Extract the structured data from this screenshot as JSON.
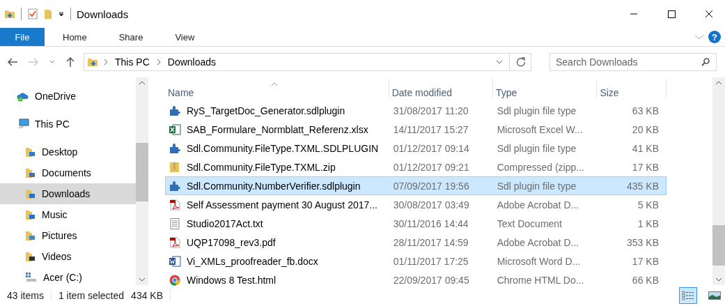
{
  "window": {
    "title": "Downloads"
  },
  "ribbon": {
    "tabs": [
      {
        "label": "File",
        "kind": "file",
        "selected": false
      },
      {
        "label": "Home",
        "kind": "tab",
        "selected": false
      },
      {
        "label": "Share",
        "kind": "tab",
        "selected": false
      },
      {
        "label": "View",
        "kind": "tab",
        "selected": false
      }
    ],
    "help": "?"
  },
  "address": {
    "crumbs": [
      "This PC",
      "Downloads"
    ],
    "search": {
      "placeholder": "Search Downloads"
    }
  },
  "sidebar": {
    "items": [
      {
        "label": "OneDrive",
        "kind": "onedrive",
        "selected": false
      },
      {
        "label": "This PC",
        "kind": "pc",
        "selected": false,
        "children": [
          {
            "label": "Desktop",
            "kind": "desktop",
            "selected": false
          },
          {
            "label": "Documents",
            "kind": "documents",
            "selected": false
          },
          {
            "label": "Downloads",
            "kind": "downloads",
            "selected": true
          },
          {
            "label": "Music",
            "kind": "music",
            "selected": false
          },
          {
            "label": "Pictures",
            "kind": "pictures",
            "selected": false
          },
          {
            "label": "Videos",
            "kind": "videos",
            "selected": false
          },
          {
            "label": "Acer (C:)",
            "kind": "drive",
            "selected": false
          }
        ]
      }
    ]
  },
  "table": {
    "columns": [
      "Name",
      "Date modified",
      "Type",
      "Size"
    ],
    "rows": [
      {
        "kind": "plugin",
        "name": "RyS_TargetDoc_Generator.sdlplugin",
        "date": "31/08/2017 11:20",
        "type": "Sdl plugin file type",
        "size": "63 KB",
        "selected": false
      },
      {
        "kind": "excel",
        "name": "SAB_Formulare_Normblatt_Referenz.xlsx",
        "date": "14/11/2017 15:27",
        "type": "Microsoft Excel W...",
        "size": "20 KB",
        "selected": false
      },
      {
        "kind": "plugin",
        "name": "Sdl.Community.FileType.TXML.SDLPLUGIN",
        "date": "01/12/2017 09:14",
        "type": "Sdl plugin file type",
        "size": "41 KB",
        "selected": false
      },
      {
        "kind": "zip",
        "name": "Sdl.Community.FileType.TXML.zip",
        "date": "01/12/2017 09:21",
        "type": "Compressed (zipp...",
        "size": "17 KB",
        "selected": false
      },
      {
        "kind": "plugin",
        "name": "Sdl.Community.NumberVerifier.sdlplugin",
        "date": "07/09/2017 19:56",
        "type": "Sdl plugin file type",
        "size": "435 KB",
        "selected": true
      },
      {
        "kind": "pdf",
        "name": "Self Assessment payment 30 August 2017...",
        "date": "30/08/2017 03:49",
        "type": "Adobe Acrobat D...",
        "size": "5 KB",
        "selected": false
      },
      {
        "kind": "text",
        "name": "Studio2017Act.txt",
        "date": "30/11/2016 14:44",
        "type": "Text Document",
        "size": "1 KB",
        "selected": false
      },
      {
        "kind": "pdf",
        "name": "UQP17098_rev3.pdf",
        "date": "28/11/2017 14:59",
        "type": "Adobe Acrobat D...",
        "size": "353 KB",
        "selected": false
      },
      {
        "kind": "word",
        "name": "Vi_XMLs_proofreader_fb.docx",
        "date": "01/11/2017 17:25",
        "type": "Microsoft Word D...",
        "size": "17 KB",
        "selected": false
      },
      {
        "kind": "chrome",
        "name": "Windows 8 Test.html",
        "date": "22/09/2017 09:45",
        "type": "Chrome HTML Do...",
        "size": "66 KB",
        "selected": false
      }
    ]
  },
  "status_bar": {
    "count": "43 items",
    "selection": "1 item selected",
    "size": "434 KB",
    "views": [
      {
        "kind": "details",
        "selected": true
      },
      {
        "kind": "thumbnails",
        "selected": false
      }
    ]
  }
}
